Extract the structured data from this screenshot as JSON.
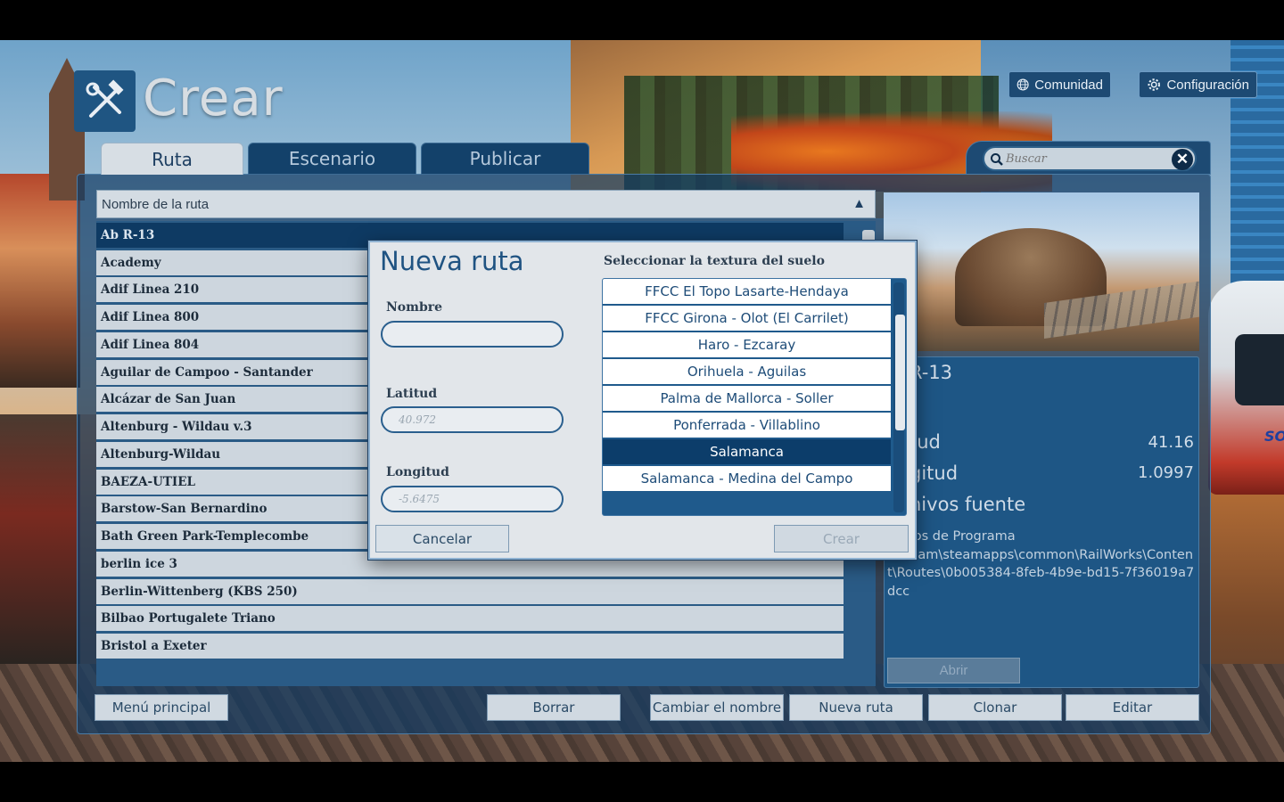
{
  "app": {
    "title": "Crear"
  },
  "header": {
    "community_label": "Comunidad",
    "settings_label": "Configuración"
  },
  "tabs": [
    {
      "label": "Ruta",
      "active": true
    },
    {
      "label": "Escenario",
      "active": false
    },
    {
      "label": "Publicar",
      "active": false
    }
  ],
  "search": {
    "placeholder": "Buscar",
    "value": ""
  },
  "route_list": {
    "header": "Nombre de la ruta",
    "rows": [
      "Ab R-13",
      "Academy",
      "Adif Linea 210",
      "Adif Linea 800",
      "Adif Linea 804",
      "Aguilar de Campoo - Santander",
      "Alcázar de San Juan",
      "Altenburg - Wildau v.3",
      "Altenburg-Wildau",
      "BAEZA-UTIEL",
      "Barstow-San Bernardino",
      "Bath Green Park-Templecombe",
      "berlin ice 3",
      "Berlin-Wittenberg (KBS 250)",
      "Bilbao Portugalete Triano",
      "Bristol a Exeter"
    ],
    "selected_index": 0
  },
  "details": {
    "title": "R-13",
    "lat_label": "tud",
    "lat_value": "41.16",
    "lon_label": "gitud",
    "lon_value": "1.0997",
    "files_label": "hivos fuente",
    "path": "chivos de Programa\n)\\Steam\\steamapps\\common\\RailWorks\\Content\\Routes\\0b005384-8feb-4b9e-bd15-7f36019a7dcc",
    "open_label": "Abrir"
  },
  "bottom_buttons": {
    "main_menu": "Menú principal",
    "delete": "Borrar",
    "rename": "Cambiar el nombre",
    "new_route": "Nueva ruta",
    "clone": "Clonar",
    "edit": "Editar"
  },
  "modal": {
    "title": "Nueva ruta",
    "name_label": "Nombre",
    "name_value": "",
    "lat_label": "Latitud",
    "lat_placeholder": "40.972",
    "lon_label": "Longitud",
    "lon_placeholder": "-5.6475",
    "texture_label": "Seleccionar la textura del suelo",
    "textures": [
      "FFCC El Topo Lasarte-Hendaya",
      "FFCC Girona - Olot (El Carrilet)",
      "Haro - Ezcaray",
      "Orihuela -  Aguilas",
      "Palma de Mallorca - Soller",
      "Ponferrada - Villablino",
      "Salamanca",
      "Salamanca - Medina del Campo"
    ],
    "selected_texture_index": 6,
    "cancel_label": "Cancelar",
    "create_label": "Crear"
  },
  "colors": {
    "accent": "#1f5382",
    "selection": "#0c3d6a",
    "panel": "#1e5685"
  }
}
